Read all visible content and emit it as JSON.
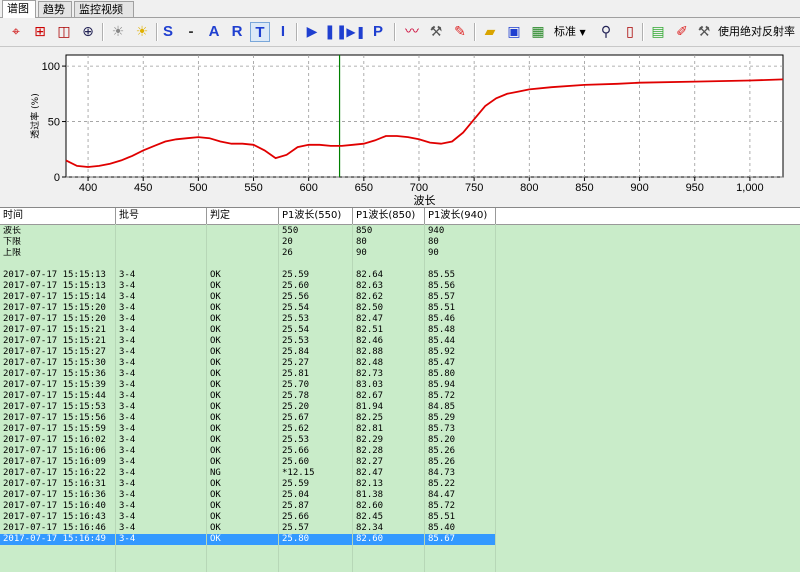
{
  "tabs": [
    {
      "label": "谱图",
      "active": true
    },
    {
      "label": "趋势",
      "active": false
    },
    {
      "label": "监控视频",
      "active": false
    }
  ],
  "toolbar": {
    "icons": [
      "crosshair-icon",
      "grid-icon",
      "split-icon",
      "zoom-icon",
      "bulb-off-icon",
      "bulb-on-icon"
    ],
    "letters": [
      "S",
      "-",
      "A",
      "R",
      "T",
      "I"
    ],
    "play": [
      "play-icon",
      "pause-icon",
      "step-icon",
      "P"
    ],
    "right_icons": [
      "trend-icon",
      "hammer-icon",
      "brush-icon",
      "folder-icon",
      "save-icon",
      "image-icon"
    ],
    "mode_label": "标准",
    "absolute_label": "使用绝对反射率"
  },
  "chart_data": {
    "type": "line",
    "xlabel": "波长",
    "ylabel": "透过率 (%)",
    "xlim": [
      380,
      1030
    ],
    "ylim": [
      0,
      110
    ],
    "xticks": [
      "400",
      "450",
      "500",
      "550",
      "600",
      "650",
      "700",
      "750",
      "800",
      "850",
      "900",
      "950",
      "1,000"
    ],
    "yticks": [
      "0",
      "50",
      "100"
    ],
    "marker_x": 628,
    "series": [
      {
        "color": "#e00000",
        "x": [
          380,
          390,
          400,
          410,
          420,
          430,
          440,
          450,
          460,
          470,
          480,
          490,
          500,
          510,
          520,
          530,
          540,
          550,
          560,
          570,
          580,
          590,
          600,
          610,
          620,
          630,
          640,
          650,
          660,
          670,
          680,
          690,
          700,
          710,
          720,
          730,
          740,
          750,
          760,
          770,
          780,
          790,
          800,
          820,
          850,
          880,
          900,
          950,
          1000,
          1030
        ],
        "y": [
          15,
          10,
          9,
          10,
          12,
          15,
          19,
          24,
          28,
          32,
          34,
          35,
          36,
          35,
          32,
          30,
          30,
          29,
          24,
          17,
          20,
          27,
          29,
          29,
          28,
          28,
          29,
          30,
          33,
          37,
          37,
          36,
          34,
          31,
          30,
          32,
          40,
          52,
          64,
          71,
          75,
          77,
          79,
          81,
          83,
          84,
          85,
          86,
          87,
          88
        ]
      }
    ]
  },
  "table": {
    "headers": [
      "时间",
      "批号",
      "判定",
      "P1波长(550)",
      "P1波长(850)",
      "P1波长(940)"
    ],
    "spec_rows": [
      [
        "波长",
        "",
        "",
        "550",
        "850",
        "940"
      ],
      [
        "下限",
        "",
        "",
        "20",
        "80",
        "80"
      ],
      [
        "上限",
        "",
        "",
        "26",
        "90",
        "90"
      ],
      [
        "",
        "",
        "",
        "",
        "",
        ""
      ]
    ],
    "rows": [
      [
        "2017-07-17 15:15:13",
        "3-4",
        "OK",
        "25.59",
        "82.64",
        "85.55"
      ],
      [
        "2017-07-17 15:15:13",
        "3-4",
        "OK",
        "25.60",
        "82.63",
        "85.56"
      ],
      [
        "2017-07-17 15:15:14",
        "3-4",
        "OK",
        "25.56",
        "82.62",
        "85.57"
      ],
      [
        "2017-07-17 15:15:20",
        "3-4",
        "OK",
        "25.54",
        "82.50",
        "85.51"
      ],
      [
        "2017-07-17 15:15:20",
        "3-4",
        "OK",
        "25.53",
        "82.47",
        "85.46"
      ],
      [
        "2017-07-17 15:15:21",
        "3-4",
        "OK",
        "25.54",
        "82.51",
        "85.48"
      ],
      [
        "2017-07-17 15:15:21",
        "3-4",
        "OK",
        "25.53",
        "82.46",
        "85.44"
      ],
      [
        "2017-07-17 15:15:27",
        "3-4",
        "OK",
        "25.84",
        "82.88",
        "85.92"
      ],
      [
        "2017-07-17 15:15:30",
        "3-4",
        "OK",
        "25.27",
        "82.48",
        "85.47"
      ],
      [
        "2017-07-17 15:15:36",
        "3-4",
        "OK",
        "25.81",
        "82.73",
        "85.80"
      ],
      [
        "2017-07-17 15:15:39",
        "3-4",
        "OK",
        "25.70",
        "83.03",
        "85.94"
      ],
      [
        "2017-07-17 15:15:44",
        "3-4",
        "OK",
        "25.78",
        "82.67",
        "85.72"
      ],
      [
        "2017-07-17 15:15:53",
        "3-4",
        "OK",
        "25.20",
        "81.94",
        "84.85"
      ],
      [
        "2017-07-17 15:15:56",
        "3-4",
        "OK",
        "25.67",
        "82.25",
        "85.29"
      ],
      [
        "2017-07-17 15:15:59",
        "3-4",
        "OK",
        "25.62",
        "82.81",
        "85.73"
      ],
      [
        "2017-07-17 15:16:02",
        "3-4",
        "OK",
        "25.53",
        "82.29",
        "85.20"
      ],
      [
        "2017-07-17 15:16:06",
        "3-4",
        "OK",
        "25.66",
        "82.28",
        "85.26"
      ],
      [
        "2017-07-17 15:16:09",
        "3-4",
        "OK",
        "25.60",
        "82.27",
        "85.26"
      ],
      [
        "2017-07-17 15:16:22",
        "3-4",
        "NG",
        "*12.15",
        "82.47",
        "84.73"
      ],
      [
        "2017-07-17 15:16:31",
        "3-4",
        "OK",
        "25.59",
        "82.13",
        "85.22"
      ],
      [
        "2017-07-17 15:16:36",
        "3-4",
        "OK",
        "25.04",
        "81.38",
        "84.47"
      ],
      [
        "2017-07-17 15:16:40",
        "3-4",
        "OK",
        "25.87",
        "82.60",
        "85.72"
      ],
      [
        "2017-07-17 15:16:43",
        "3-4",
        "OK",
        "25.66",
        "82.45",
        "85.51"
      ],
      [
        "2017-07-17 15:16:46",
        "3-4",
        "OK",
        "25.57",
        "82.34",
        "85.40"
      ],
      [
        "2017-07-17 15:16:49",
        "3-4",
        "OK",
        "25.80",
        "82.60",
        "85.67"
      ]
    ],
    "selected_index": 24
  }
}
